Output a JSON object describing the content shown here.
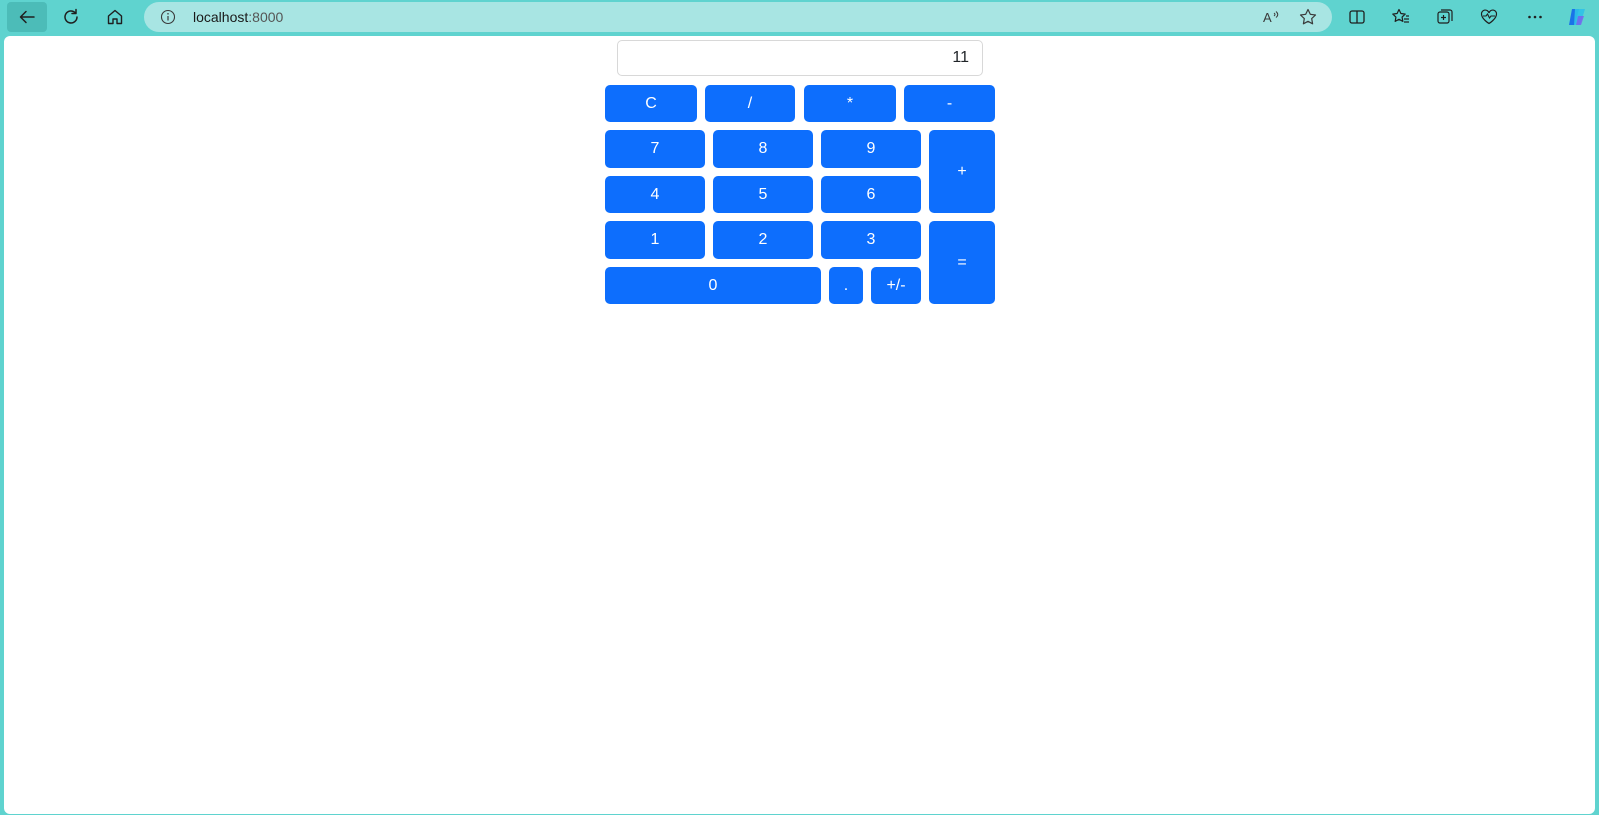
{
  "browser": {
    "address": {
      "host": "localhost",
      "port": ":8000"
    },
    "icons": {
      "back": "back-arrow-icon",
      "refresh": "refresh-icon",
      "home": "home-icon",
      "info": "info-icon",
      "read_aloud": "read-aloud-icon",
      "favorite": "star-icon",
      "split_screen": "split-screen-icon",
      "favorites": "favorites-icon",
      "collections": "collections-icon",
      "performance": "heart-pulse-icon",
      "more": "more-icon",
      "copilot": "copilot-icon"
    },
    "chrome_color": "#5fd3cf"
  },
  "calculator": {
    "display_value": "11",
    "accent_color": "#0d6efd",
    "keys": {
      "clear": "C",
      "divide": "/",
      "multiply": "*",
      "subtract": "-",
      "seven": "7",
      "eight": "8",
      "nine": "9",
      "add": "+",
      "four": "4",
      "five": "5",
      "six": "6",
      "one": "1",
      "two": "2",
      "three": "3",
      "equals": "=",
      "zero": "0",
      "decimal": ".",
      "negate": "+/-"
    }
  }
}
